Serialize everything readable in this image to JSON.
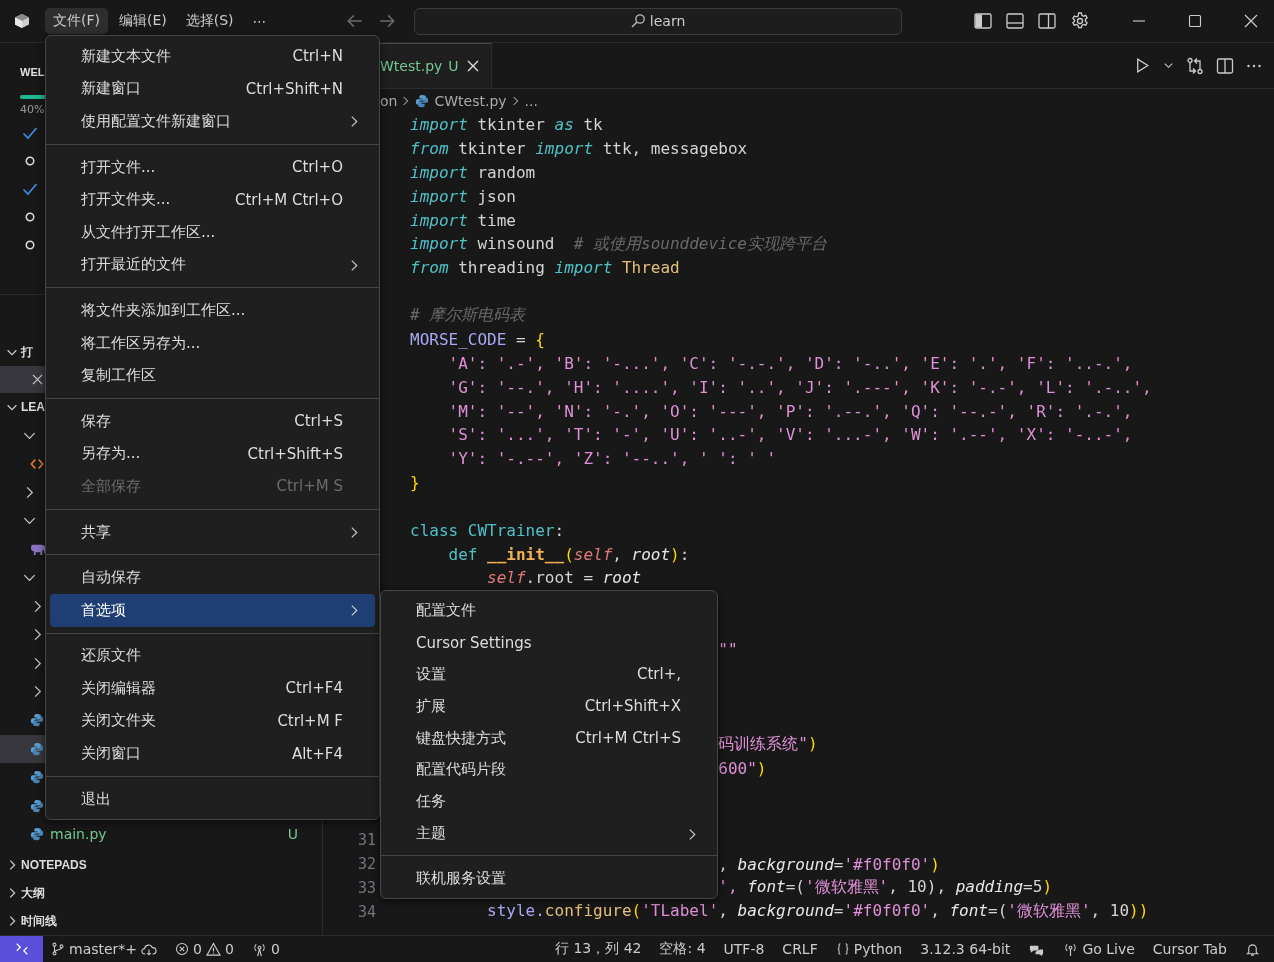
{
  "title_bar": {
    "menus": [
      {
        "label": "文件(F)",
        "selected": true
      },
      {
        "label": "编辑(E)",
        "selected": false
      },
      {
        "label": "选择(S)",
        "selected": false
      }
    ],
    "more": "⋯",
    "search": {
      "value": "learn"
    }
  },
  "sidebar": {
    "welcome": {
      "title": "WEL",
      "progress": {
        "level": 0.4,
        "reading": "40%"
      },
      "steps": [
        {
          "checked": true
        },
        {
          "checked": false
        },
        {
          "checked": true
        },
        {
          "checked": false
        },
        {
          "checked": false
        }
      ]
    },
    "open_editors": {
      "title": "打",
      "expanded": true,
      "items": [
        {
          "selected": true
        }
      ]
    },
    "explorer": {
      "title": "LEA",
      "expanded": true,
      "tree": [
        {
          "kind": "folder",
          "expanded": true,
          "selected": false,
          "children": [
            {
              "kind": "markup",
              "selected": false
            }
          ]
        },
        {
          "kind": "folder",
          "expanded": false,
          "selected": false
        },
        {
          "kind": "folder",
          "expanded": true,
          "selected": false,
          "children": [
            {
              "kind": "php",
              "selected": false
            }
          ]
        },
        {
          "kind": "folder",
          "expanded": true,
          "selected": false,
          "children": [
            {
              "kind": "folder",
              "expanded": false,
              "selected": false
            },
            {
              "kind": "folder",
              "expanded": false,
              "selected": false
            },
            {
              "kind": "folder",
              "expanded": false,
              "selected": false
            },
            {
              "kind": "folder",
              "expanded": false,
              "selected": false
            },
            {
              "kind": "python",
              "selected": false
            },
            {
              "kind": "python",
              "selected": true
            },
            {
              "kind": "python",
              "selected": false
            },
            {
              "kind": "python",
              "selected": false
            },
            {
              "kind": "python",
              "selected": false,
              "label": "main.py",
              "badge": "U"
            }
          ]
        }
      ]
    },
    "panels": [
      {
        "title": "NOTEPADS"
      },
      {
        "title": "大纲"
      },
      {
        "title": "时间线"
      }
    ]
  },
  "editor": {
    "tab": {
      "label": "Wtest.py",
      "badge": "U"
    },
    "breadcrumb": [
      "on",
      "CWtest.py",
      "..."
    ],
    "lines": [
      {
        "kind": "top",
        "tokens": [
          {
            "text": "import",
            "kind": "kw"
          },
          {
            "text": " tkinter ",
            "kind": "plain"
          },
          {
            "text": "as",
            "kind": "kw"
          },
          {
            "text": " tk",
            "kind": "plain"
          }
        ]
      },
      {
        "kind": "top",
        "tokens": [
          {
            "text": "from",
            "kind": "kw"
          },
          {
            "text": " tkinter ",
            "kind": "plain"
          },
          {
            "text": "import",
            "kind": "kw"
          },
          {
            "text": " ttk, messagebox",
            "kind": "plain"
          }
        ]
      },
      {
        "kind": "top",
        "tokens": [
          {
            "text": "import",
            "kind": "kw"
          },
          {
            "text": " random",
            "kind": "plain"
          }
        ]
      },
      {
        "kind": "top",
        "tokens": [
          {
            "text": "import",
            "kind": "kw"
          },
          {
            "text": " json",
            "kind": "plain"
          }
        ]
      },
      {
        "kind": "top",
        "tokens": [
          {
            "text": "import",
            "kind": "kw"
          },
          {
            "text": " time",
            "kind": "plain"
          }
        ]
      },
      {
        "kind": "top",
        "tokens": [
          {
            "text": "import",
            "kind": "kw"
          },
          {
            "text": " winsound  ",
            "kind": "plain"
          },
          {
            "text": "# 或使用sounddevice实现跨平台",
            "kind": "comment"
          }
        ]
      },
      {
        "kind": "top",
        "tokens": [
          {
            "text": "from",
            "kind": "kw"
          },
          {
            "text": " threading ",
            "kind": "plain"
          },
          {
            "text": "import ",
            "kind": "kw"
          },
          {
            "text": "Thread",
            "kind": "cls"
          }
        ]
      },
      {
        "kind": "blank"
      },
      {
        "kind": "top",
        "tokens": [
          {
            "text": "# 摩尔斯电码表",
            "kind": "comment"
          }
        ]
      },
      {
        "kind": "top",
        "tokens": [
          {
            "text": "MORSE_CODE",
            "kind": "var"
          },
          {
            "text": " = ",
            "kind": "plain"
          },
          {
            "text": "{",
            "kind": "brace"
          }
        ]
      },
      {
        "kind": "body",
        "tokens": [
          {
            "text": "'A': '.-', 'B': '-...', 'C': '-.-.', 'D': '-..', 'E': '.', 'F': '..-.',",
            "kind": "str"
          }
        ]
      },
      {
        "kind": "body",
        "tokens": [
          {
            "text": "'G': '--.', 'H': '....', 'I': '..', 'J': '.---', 'K': '-.-', 'L': '.-..',",
            "kind": "str"
          }
        ]
      },
      {
        "kind": "body",
        "tokens": [
          {
            "text": "'M': '--', 'N': '-.', 'O': '---', 'P': '.--.', 'Q': '--.-', 'R': '.-.',",
            "kind": "str"
          }
        ]
      },
      {
        "kind": "body",
        "tokens": [
          {
            "text": "'S': '...', 'T': '-', 'U': '..-', 'V': '...-', 'W': '.--', 'X': '-..-',",
            "kind": "str"
          }
        ]
      },
      {
        "kind": "body",
        "tokens": [
          {
            "text": "'Y': '-.--', 'Z': '--..', ' ': ' '",
            "kind": "str"
          }
        ]
      },
      {
        "kind": "top",
        "tokens": [
          {
            "text": "}",
            "kind": "brace"
          }
        ]
      },
      {
        "kind": "blank"
      },
      {
        "kind": "top",
        "tokens": [
          {
            "text": "class CWTrainer",
            "kind": "decl"
          },
          {
            "text": ":",
            "kind": "plain"
          }
        ]
      },
      {
        "kind": "body",
        "tokens": [
          {
            "text": "def ",
            "kind": "decl"
          },
          {
            "text": "__init__",
            "kind": "fn"
          },
          {
            "text": "(",
            "kind": "brace"
          },
          {
            "text": "self",
            "kind": "self"
          },
          {
            "text": ", ",
            "kind": "plain"
          },
          {
            "text": "root",
            "kind": "param"
          },
          {
            "text": ")",
            "kind": "brace"
          },
          {
            "text": ":",
            "kind": "plain"
          }
        ]
      },
      {
        "kind": "inner",
        "tokens": [
          {
            "text": "self",
            "kind": "self"
          },
          {
            "text": ".root = ",
            "kind": "plain"
          },
          {
            "text": "root",
            "kind": "param"
          }
        ]
      },
      {
        "kind": "blank"
      },
      {
        "kind": "blank"
      },
      {
        "kind": "fragment",
        "tokens": [
          {
            "text": "\"\"",
            "kind": "str"
          }
        ]
      },
      {
        "kind": "blank"
      },
      {
        "kind": "blank"
      },
      {
        "kind": "blank"
      },
      {
        "kind": "fragment",
        "tokens": [
          {
            "text": "码训练系统\"",
            "kind": "str"
          },
          {
            "text": ")",
            "kind": "brace"
          }
        ]
      },
      {
        "kind": "fragment",
        "tokens": [
          {
            "text": "600\"",
            "kind": "str"
          },
          {
            "text": ")",
            "kind": "brace"
          }
        ]
      },
      {
        "kind": "blank"
      },
      {
        "kind": "blank"
      },
      {
        "kind": "blank",
        "number": "31"
      },
      {
        "kind": "fragment",
        "number": "32",
        "tokens": [
          {
            "text": ", ",
            "kind": "plain"
          },
          {
            "text": "background",
            "kind": "param"
          },
          {
            "text": "=",
            "kind": "plain"
          },
          {
            "text": "'#f0f0f0'",
            "kind": "str"
          },
          {
            "text": ")",
            "kind": "brace"
          }
        ]
      },
      {
        "kind": "fragment",
        "number": "33",
        "tokens": [
          {
            "text": "', ",
            "kind": "str"
          },
          {
            "text": "font",
            "kind": "param"
          },
          {
            "text": "=(",
            "kind": "plain"
          },
          {
            "text": "'微软雅黑'",
            "kind": "str"
          },
          {
            "text": ", ",
            "kind": "plain"
          },
          {
            "text": "10",
            "kind": "num"
          },
          {
            "text": "), ",
            "kind": "plain"
          },
          {
            "text": "padding",
            "kind": "param"
          },
          {
            "text": "=",
            "kind": "plain"
          },
          {
            "text": "5",
            "kind": "num"
          },
          {
            "text": ")",
            "kind": "brace"
          }
        ]
      },
      {
        "kind": "inner",
        "number": "34",
        "tokens": [
          {
            "text": "style.",
            "kind": "var"
          },
          {
            "text": "configure",
            "kind": "cls"
          },
          {
            "text": "(",
            "kind": "brace"
          },
          {
            "text": "'TLabel'",
            "kind": "str"
          },
          {
            "text": ", ",
            "kind": "plain"
          },
          {
            "text": "background",
            "kind": "param"
          },
          {
            "text": "=",
            "kind": "plain"
          },
          {
            "text": "'#f0f0f0'",
            "kind": "str"
          },
          {
            "text": ", ",
            "kind": "plain"
          },
          {
            "text": "font",
            "kind": "param"
          },
          {
            "text": "=(",
            "kind": "plain"
          },
          {
            "text": "'微软雅黑'",
            "kind": "str"
          },
          {
            "text": ", ",
            "kind": "plain"
          },
          {
            "text": "10",
            "kind": "num"
          },
          {
            "text": "))",
            "kind": "brace"
          }
        ]
      }
    ]
  },
  "file_menu": {
    "items": [
      {
        "kind": "item",
        "label": "新建文本文件",
        "shortcut": "Ctrl+N",
        "submenu": false,
        "disabled": false,
        "selected": false
      },
      {
        "kind": "item",
        "label": "新建窗口",
        "shortcut": "Ctrl+Shift+N",
        "submenu": false,
        "disabled": false,
        "selected": false
      },
      {
        "kind": "item",
        "label": "使用配置文件新建窗口",
        "submenu": true,
        "disabled": false,
        "selected": false
      },
      {
        "kind": "separator"
      },
      {
        "kind": "item",
        "label": "打开文件...",
        "shortcut": "Ctrl+O",
        "submenu": false,
        "disabled": false,
        "selected": false
      },
      {
        "kind": "item",
        "label": "打开文件夹...",
        "shortcut": "Ctrl+M Ctrl+O",
        "submenu": false,
        "disabled": false,
        "selected": false
      },
      {
        "kind": "item",
        "label": "从文件打开工作区...",
        "submenu": false,
        "disabled": false,
        "selected": false
      },
      {
        "kind": "item",
        "label": "打开最近的文件",
        "submenu": true,
        "disabled": false,
        "selected": false
      },
      {
        "kind": "separator"
      },
      {
        "kind": "item",
        "label": "将文件夹添加到工作区...",
        "submenu": false,
        "disabled": false,
        "selected": false
      },
      {
        "kind": "item",
        "label": "将工作区另存为...",
        "submenu": false,
        "disabled": false,
        "selected": false
      },
      {
        "kind": "item",
        "label": "复制工作区",
        "submenu": false,
        "disabled": false,
        "selected": false
      },
      {
        "kind": "separator"
      },
      {
        "kind": "item",
        "label": "保存",
        "shortcut": "Ctrl+S",
        "submenu": false,
        "disabled": false,
        "selected": false
      },
      {
        "kind": "item",
        "label": "另存为...",
        "shortcut": "Ctrl+Shift+S",
        "submenu": false,
        "disabled": false,
        "selected": false
      },
      {
        "kind": "item",
        "label": "全部保存",
        "shortcut": "Ctrl+M S",
        "submenu": false,
        "disabled": true,
        "selected": false
      },
      {
        "kind": "separator"
      },
      {
        "kind": "item",
        "label": "共享",
        "submenu": true,
        "disabled": false,
        "selected": false
      },
      {
        "kind": "separator"
      },
      {
        "kind": "item",
        "label": "自动保存",
        "submenu": false,
        "disabled": false,
        "selected": false
      },
      {
        "kind": "item",
        "label": "首选项",
        "submenu": true,
        "disabled": false,
        "selected": true
      },
      {
        "kind": "separator"
      },
      {
        "kind": "item",
        "label": "还原文件",
        "submenu": false,
        "disabled": false,
        "selected": false
      },
      {
        "kind": "item",
        "label": "关闭编辑器",
        "shortcut": "Ctrl+F4",
        "submenu": false,
        "disabled": false,
        "selected": false
      },
      {
        "kind": "item",
        "label": "关闭文件夹",
        "shortcut": "Ctrl+M F",
        "submenu": false,
        "disabled": false,
        "selected": false
      },
      {
        "kind": "item",
        "label": "关闭窗口",
        "shortcut": "Alt+F4",
        "submenu": false,
        "disabled": false,
        "selected": false
      },
      {
        "kind": "separator"
      },
      {
        "kind": "item",
        "label": "退出",
        "submenu": false,
        "disabled": false,
        "selected": false
      }
    ]
  },
  "preferences_menu": {
    "items": [
      {
        "kind": "item",
        "label": "配置文件",
        "submenu": false,
        "disabled": false,
        "selected": false
      },
      {
        "kind": "item",
        "label": "Cursor Settings",
        "submenu": false,
        "disabled": false,
        "selected": false
      },
      {
        "kind": "item",
        "label": "设置",
        "shortcut": "Ctrl+,",
        "submenu": false,
        "disabled": false,
        "selected": false
      },
      {
        "kind": "item",
        "label": "扩展",
        "shortcut": "Ctrl+Shift+X",
        "submenu": false,
        "disabled": false,
        "selected": false
      },
      {
        "kind": "item",
        "label": "键盘快捷方式",
        "shortcut": "Ctrl+M Ctrl+S",
        "submenu": false,
        "disabled": false,
        "selected": false
      },
      {
        "kind": "item",
        "label": "配置代码片段",
        "submenu": false,
        "disabled": false,
        "selected": false
      },
      {
        "kind": "item",
        "label": "任务",
        "submenu": false,
        "disabled": false,
        "selected": false
      },
      {
        "kind": "item",
        "label": "主题",
        "submenu": true,
        "disabled": false,
        "selected": false
      },
      {
        "kind": "separator"
      },
      {
        "kind": "item",
        "label": "联机服务设置",
        "submenu": false,
        "disabled": false,
        "selected": false
      }
    ]
  },
  "status_bar": {
    "branch": "master*+",
    "errors": "0",
    "warnings": "0",
    "ports": "0",
    "position": "行 13，列 42",
    "indent": "空格: 4",
    "encoding": "UTF-8",
    "eol": "CRLF",
    "language": "Python",
    "interpreter": "3.12.3 64-bit",
    "live": "Go Live",
    "cursor_tab": "Cursor Tab"
  }
}
